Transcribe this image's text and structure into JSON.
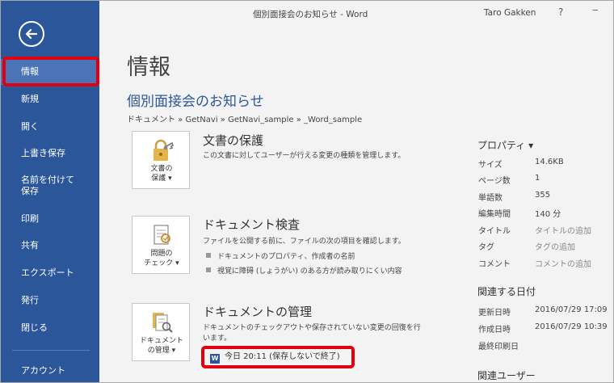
{
  "window": {
    "title": "個別面接会のお知らせ - Word",
    "user": "Taro Gakken",
    "help": "?",
    "minimize": "‒"
  },
  "sidebar": {
    "items": [
      {
        "label": "情報"
      },
      {
        "label": "新規"
      },
      {
        "label": "開く"
      },
      {
        "label": "上書き保存"
      },
      {
        "label": "名前を付けて\n保存"
      },
      {
        "label": "印刷"
      },
      {
        "label": "共有"
      },
      {
        "label": "エクスポート"
      },
      {
        "label": "発行"
      },
      {
        "label": "閉じる"
      },
      {
        "label": "アカウント"
      }
    ]
  },
  "main": {
    "heading": "情報",
    "doc_name": "個別面接会のお知らせ",
    "breadcrumb": "ドキュメント » GetNavi » GetNavi_sample » _Word_sample",
    "protect": {
      "tile_label": "文書の\n保護 ▾",
      "title": "文書の保護",
      "desc": "この文書に対してユーザーが行える変更の種類を管理します。"
    },
    "inspect": {
      "tile_label": "問題の\nチェック ▾",
      "title": "ドキュメント検査",
      "desc": "ファイルを公開する前に、ファイルの次の項目を確認します。",
      "bullets": [
        "ドキュメントのプロパティ、作成者の名前",
        "視覚に障碍 (しょうがい) のある方が読み取りにくい内容"
      ]
    },
    "manage": {
      "tile_label": "ドキュメント\nの管理 ▾",
      "title": "ドキュメントの管理",
      "desc": "ドキュメントのチェックアウトや保存されていない変更の回復を行います。",
      "version": "今日 20:11 (保存しないで終了)",
      "word_icon": "W"
    }
  },
  "properties": {
    "heading": "プロパティ ▾",
    "rows": [
      {
        "label": "サイズ",
        "value": "14.6KB"
      },
      {
        "label": "ページ数",
        "value": "1"
      },
      {
        "label": "単語数",
        "value": "355"
      },
      {
        "label": "編集時間",
        "value": "140 分"
      },
      {
        "label": "タイトル",
        "value": "タイトルの追加"
      },
      {
        "label": "タグ",
        "value": "タグの追加"
      },
      {
        "label": "コメント",
        "value": "コメントの追加"
      }
    ],
    "dates_heading": "関連する日付",
    "dates": [
      {
        "label": "更新日時",
        "value": "2016/07/29 17:09"
      },
      {
        "label": "作成日時",
        "value": "2016/07/29 10:39"
      },
      {
        "label": "最終印刷日",
        "value": ""
      }
    ],
    "users_heading": "関連ユーザー"
  },
  "colors": {
    "sidebar": "#2b579a",
    "sidebar_active": "#4a74b5",
    "highlight": "#e0000f",
    "accent_text": "#2b579a"
  }
}
